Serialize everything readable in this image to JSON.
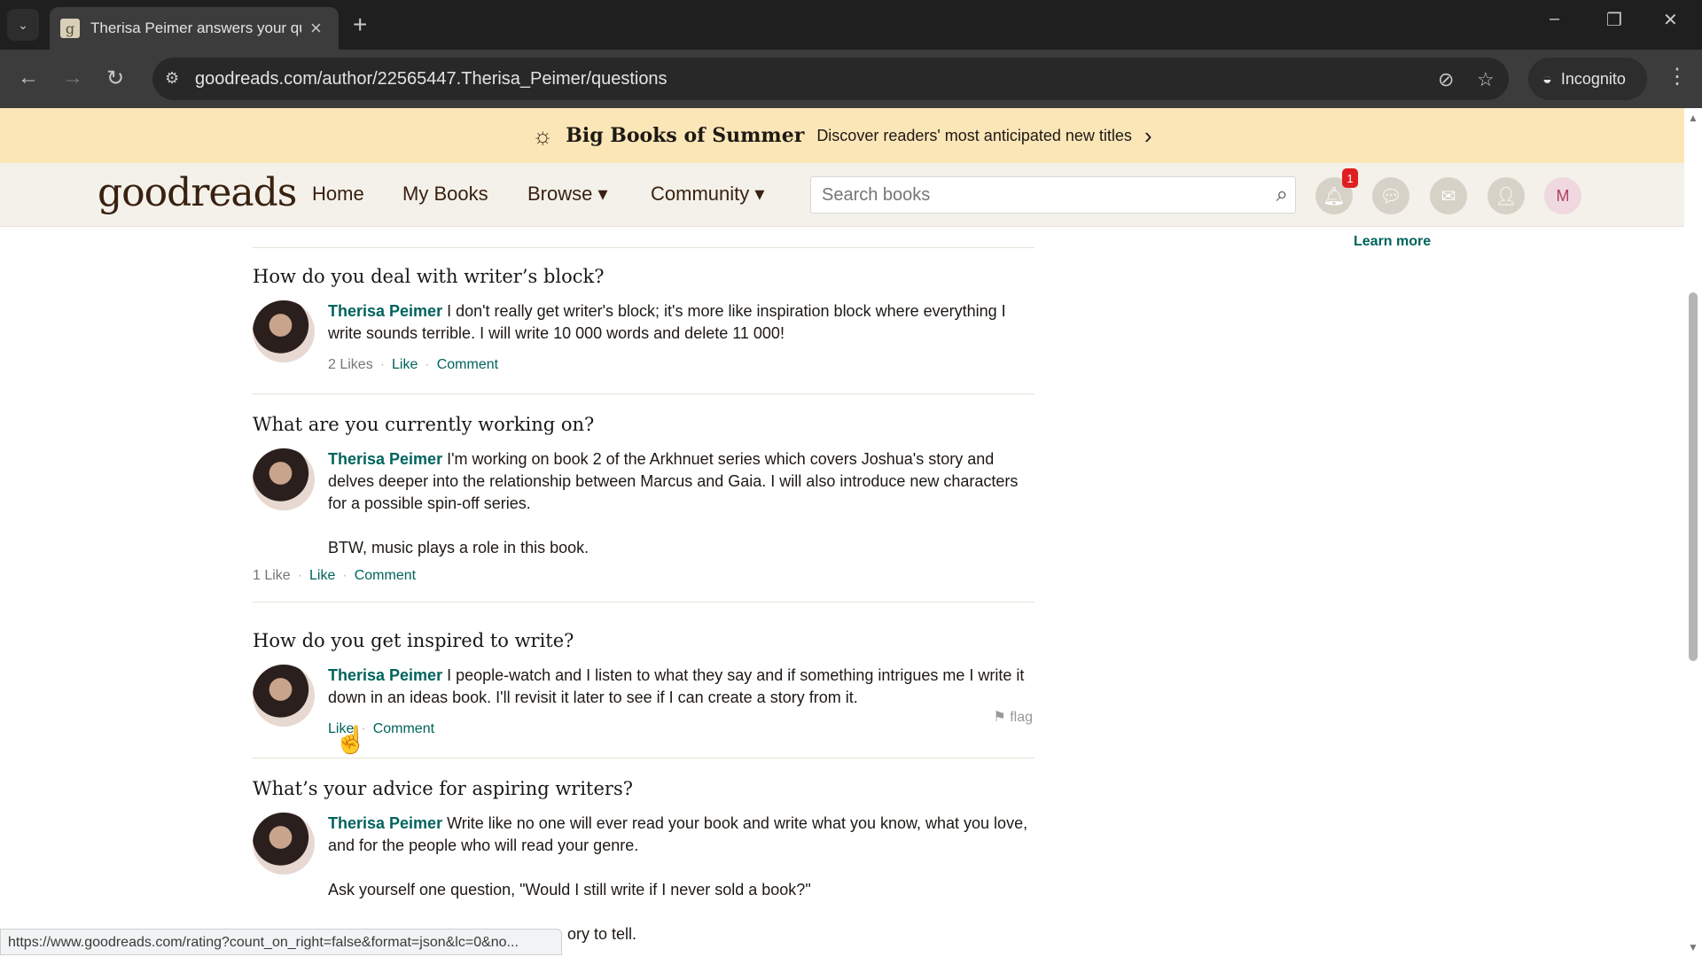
{
  "browser": {
    "tab_title": "Therisa Peimer answers your qu",
    "favicon_letter": "g",
    "url": "goodreads.com/author/22565447.Therisa_Peimer/questions",
    "incognito_label": "Incognito",
    "status_url": "https://www.goodreads.com/rating?count_on_right=false&format=json&lc=0&no..."
  },
  "banner": {
    "title": "Big Books of Summer",
    "text": "Discover readers' most anticipated new titles"
  },
  "header": {
    "logo": "goodreads",
    "nav": [
      "Home",
      "My Books",
      "Browse ▾",
      "Community ▾"
    ],
    "search_placeholder": "Search books",
    "notification_count": "1"
  },
  "sidebar": {
    "learn_more": "Learn more"
  },
  "questions": [
    {
      "question": "How do you deal with writer’s block?",
      "author": "Therisa Peimer",
      "answer": [
        "I don't really get writer's block; it's more like inspiration block where everything I write sounds terrible. I will write 10 000 words and delete 11 000!"
      ],
      "likes": "2 Likes",
      "like": "Like",
      "comment": "Comment"
    },
    {
      "question": "What are you currently working on?",
      "author": "Therisa Peimer",
      "answer": [
        "I'm working on book 2 of the Arkhnuet series which covers Joshua's story and delves deeper into the relationship between Marcus and Gaia. I will also introduce new characters for a possible spin-off series.",
        "BTW, music plays a role in this book."
      ],
      "likes": "1 Like",
      "like": "Like",
      "comment": "Comment"
    },
    {
      "question": "How do you get inspired to write?",
      "author": "Therisa Peimer",
      "answer": [
        "I people-watch and I listen to what they say and if something intrigues me I write it down in an ideas book. I'll revisit it later to see if I can create a story from it."
      ],
      "likes": "",
      "like": "Like",
      "comment": "Comment",
      "flag": "flag"
    },
    {
      "question": "What’s your advice for aspiring writers?",
      "author": "Therisa Peimer",
      "answer": [
        "Write like no one will ever read your book and write what you know, what you love, and for the people who will read your genre.",
        "Ask yourself one question, \"Would I still write if I never sold a book?\"",
        "ory to tell."
      ]
    }
  ]
}
